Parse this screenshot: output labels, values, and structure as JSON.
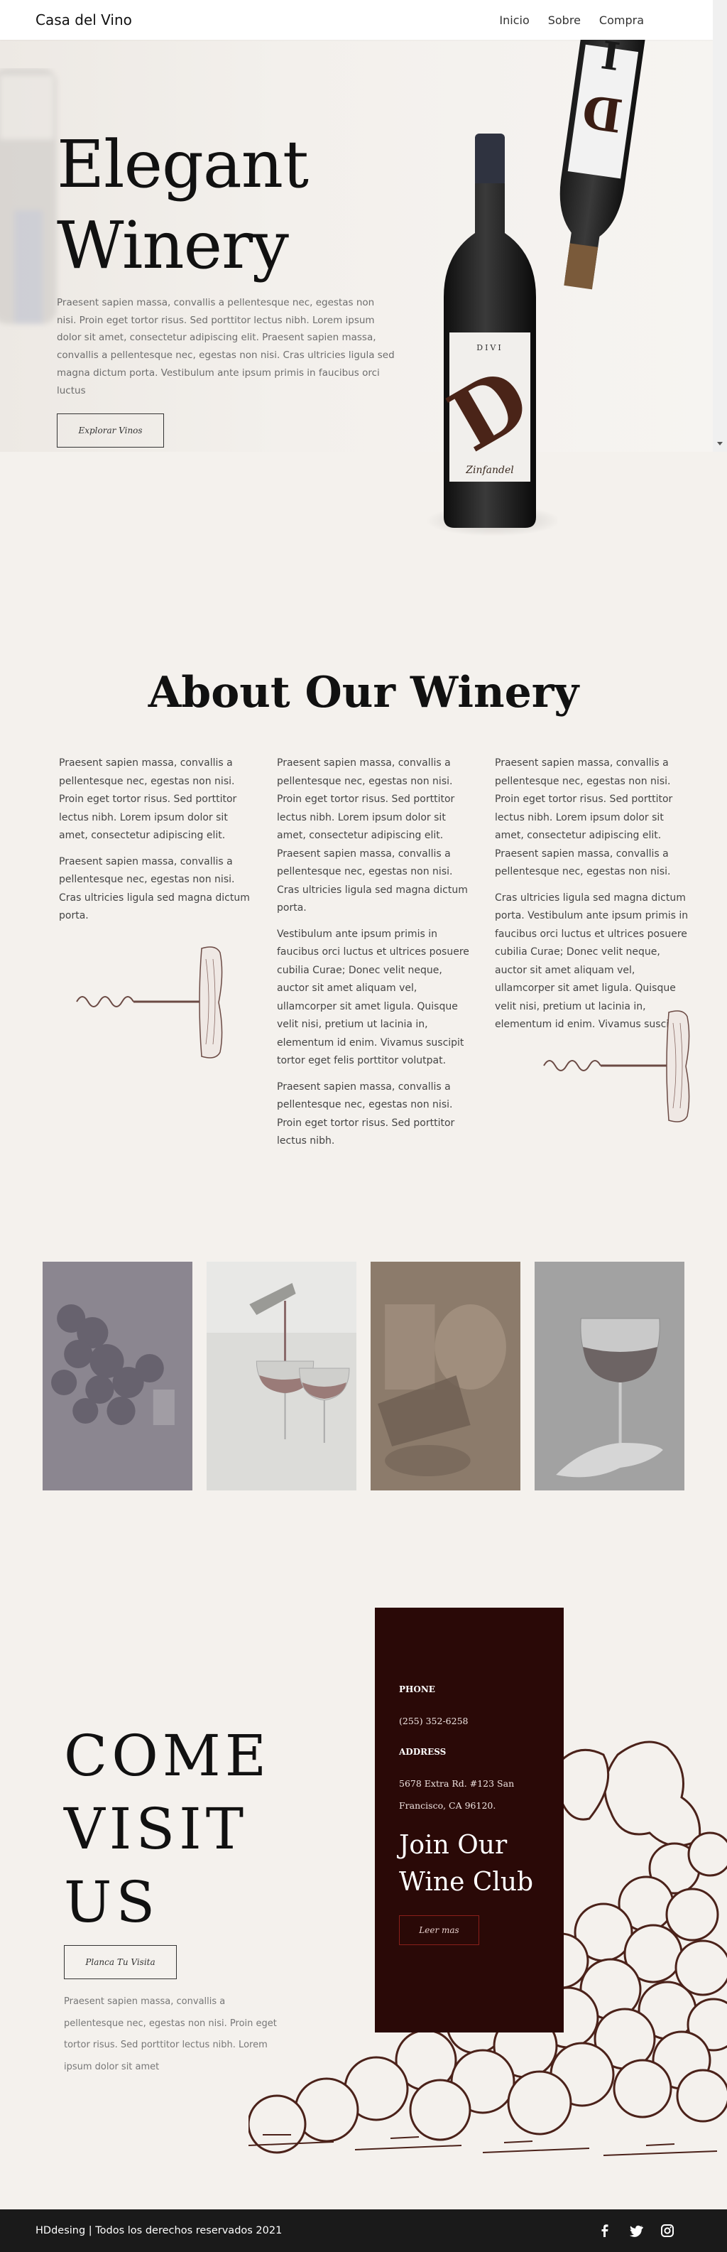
{
  "nav": {
    "brand": "Casa del Vino",
    "items": [
      {
        "label": "Inicio"
      },
      {
        "label": "Sobre"
      },
      {
        "label": "Compra"
      }
    ]
  },
  "hero": {
    "title_line1": "Elegant",
    "title_line2": "Winery",
    "text": "Praesent sapien massa, convallis a pellentesque nec, egestas non nisi. Proin eget tortor risus. Sed porttitor lectus nibh. Lorem ipsum dolor sit amet, consectetur adipiscing elit. Praesent sapien massa, convallis a pellentesque nec, egestas non nisi. Cras ultricies ligula sed magna dictum porta. Vestibulum ante ipsum primis in faucibus orci luctus",
    "button_label": "Explorar Vinos",
    "bottle_label_top": "DIVI",
    "bottle_label_letter": "D",
    "bottle_label_bottom": "Zinfandel"
  },
  "about": {
    "title": "About Our Winery",
    "col1": [
      "Praesent sapien massa, convallis a pellentesque nec, egestas non nisi. Proin eget tortor risus. Sed porttitor lectus nibh. Lorem ipsum dolor sit amet, consectetur adipiscing elit.",
      "Praesent sapien massa, convallis a pellentesque nec, egestas non nisi. Cras ultricies ligula sed magna dictum porta."
    ],
    "col2": [
      "Praesent sapien massa, convallis a pellentesque nec, egestas non nisi. Proin eget tortor risus. Sed porttitor lectus nibh. Lorem ipsum dolor sit amet, consectetur adipiscing elit. Praesent sapien massa, convallis a pellentesque nec, egestas non nisi. Cras ultricies ligula sed magna dictum porta.",
      "Vestibulum ante ipsum primis in faucibus orci luctus et ultrices posuere cubilia Curae; Donec velit neque, auctor sit amet aliquam vel, ullamcorper sit amet ligula. Quisque velit nisi, pretium ut lacinia in, elementum id enim. Vivamus suscipit tortor eget felis porttitor volutpat.",
      "Praesent sapien massa, convallis a pellentesque nec, egestas non nisi. Proin eget tortor risus. Sed porttitor lectus nibh."
    ],
    "col3": [
      "Praesent sapien massa, convallis a pellentesque nec, egestas non nisi. Proin eget tortor risus. Sed porttitor lectus nibh. Lorem ipsum dolor sit amet, consectetur adipiscing elit. Praesent sapien massa, convallis a pellentesque nec, egestas non nisi.",
      "Cras ultricies ligula sed magna dictum porta. Vestibulum ante ipsum primis in faucibus orci luctus et ultrices posuere cubilia Curae; Donec velit neque, auctor sit amet aliquam vel, ullamcorper sit amet ligula. Quisque velit nisi, pretium ut lacinia in, elementum id enim. Vivamus suscipit."
    ]
  },
  "visit": {
    "title_line1": "COME",
    "title_line2": "VISIT",
    "title_line3": "US",
    "button_label": "Planca Tu Visita",
    "text": "Praesent sapien massa, convallis a pellentesque nec, egestas non nisi. Proin eget tortor risus. Sed porttitor lectus nibh. Lorem ipsum dolor sit amet"
  },
  "card": {
    "phone_label": "PHONE",
    "phone": "(255) 352-6258",
    "address_label": "ADDRESS",
    "address": "5678 Extra Rd. #123 San Francisco, CA 96120.",
    "club_line1": "Join Our",
    "club_line2": "Wine Club",
    "button_label": "Leer mas"
  },
  "footer": {
    "text": "HDdesing | Todos los derechos reservados 2021",
    "socials": [
      "facebook-icon",
      "twitter-icon",
      "instagram-icon"
    ]
  },
  "colors": {
    "background": "#f4f1ed",
    "card": "#2a0907",
    "footer": "#1a1a1a",
    "accent_brown": "#5a2a22"
  }
}
